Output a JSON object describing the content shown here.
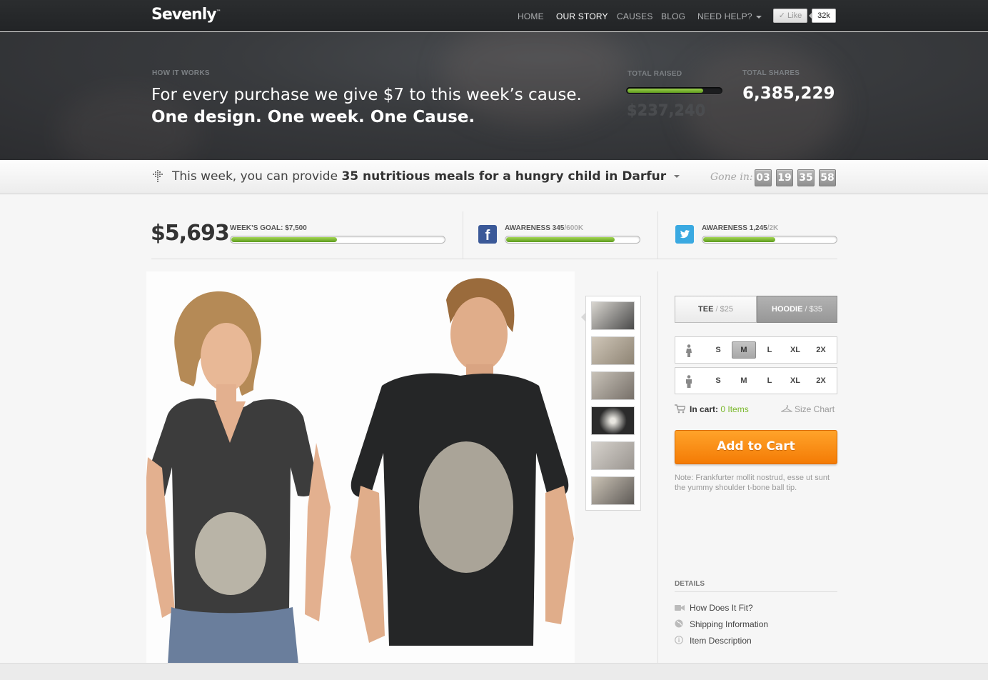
{
  "header": {
    "logo": "Sevenly",
    "logo_tm": "™",
    "nav": [
      {
        "label": "HOME",
        "active": false
      },
      {
        "label": "OUR STORY",
        "active": true
      },
      {
        "label": "CAUSES",
        "active": false
      },
      {
        "label": "BLOG",
        "active": false
      },
      {
        "label": "NEED HELP?",
        "active": false
      }
    ],
    "like_label": "Like",
    "like_count": "32k"
  },
  "hero": {
    "eyebrow": "HOW IT WORKS",
    "line1": "For every purchase we give $7 to this week’s cause.",
    "line2": "One design. One week. One Cause.",
    "total_raised_label": "TOTAL RAISED",
    "total_raised": "$237,240",
    "total_raised_progress": 0.8,
    "total_shares_label": "TOTAL SHARES",
    "total_shares": "6,385,229"
  },
  "cause": {
    "prefix": "This week, you can provide ",
    "highlight": "35 nutritious meals for a hungry child in Darfur",
    "gone_in_label": "Gone in:",
    "countdown": [
      "03",
      "19",
      "35",
      "58"
    ]
  },
  "stats": {
    "amount": "$5,693",
    "goal_label": "WEEK’S GOAL: $7,500",
    "goal_progress": 0.5,
    "facebook": {
      "label": "AWARENESS 345",
      "suffix": "/600K",
      "progress": 0.82
    },
    "twitter": {
      "label": "AWARENESS 1,245",
      "suffix": "/2K",
      "progress": 0.55
    }
  },
  "product": {
    "thumbs": [
      "thumb-1",
      "thumb-2",
      "thumb-3",
      "thumb-4",
      "thumb-5",
      "thumb-6"
    ],
    "styles": [
      {
        "name": "TEE",
        "price": "$25",
        "selected": false
      },
      {
        "name": "HOODIE",
        "price": "$35",
        "selected": true
      }
    ],
    "sizes_women": [
      "S",
      "M",
      "L",
      "XL",
      "2X"
    ],
    "sizes_men": [
      "S",
      "M",
      "L",
      "XL",
      "2X"
    ],
    "selected_size": "M",
    "in_cart_label": "In cart:",
    "in_cart_value": "0 Items",
    "size_chart": "Size Chart",
    "add_to_cart": "Add to Cart",
    "note": "Note: Frankfurter mollit nostrud, esse ut sunt the yummy shoulder t-bone ball tip.",
    "details_label": "DETAILS",
    "details": [
      "How Does It Fit?",
      "Shipping Information",
      "Item Description"
    ]
  },
  "colors": {
    "accent": "#f47b05",
    "progress": "#7ab82b",
    "facebook": "#3b5998",
    "twitter": "#2fa2dd"
  }
}
